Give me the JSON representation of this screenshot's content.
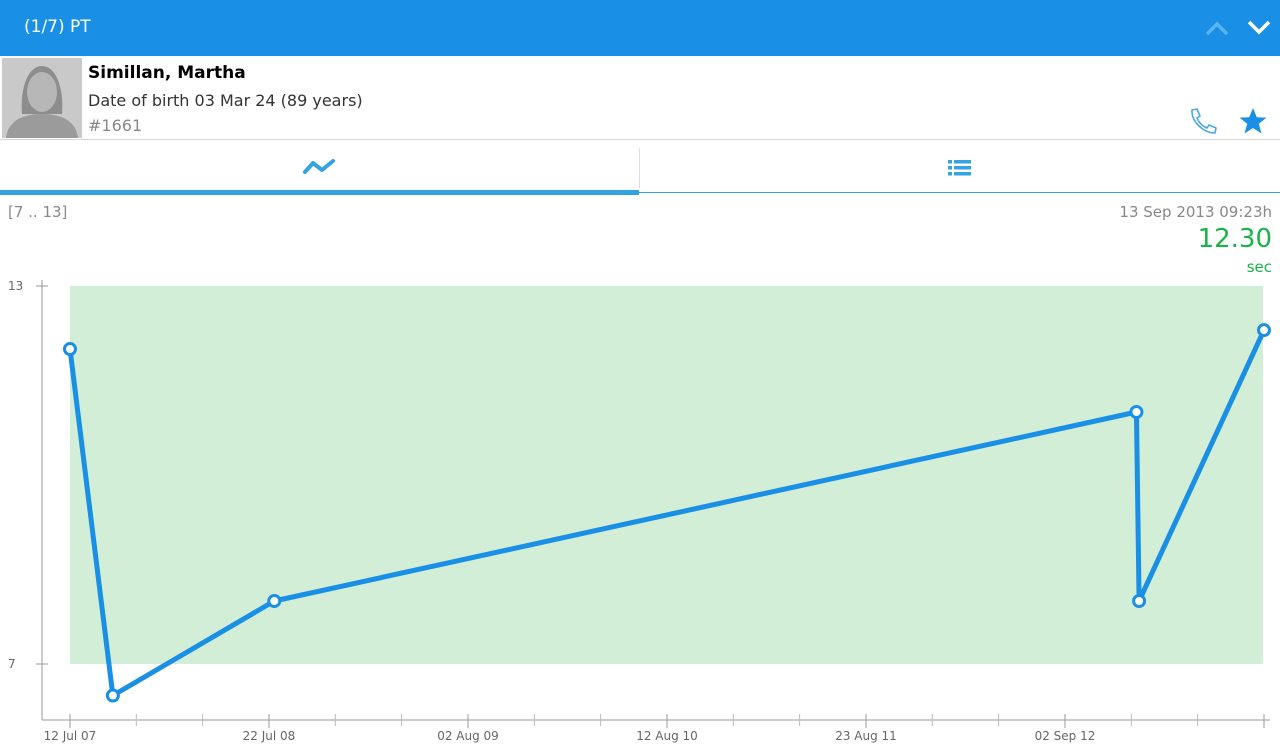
{
  "header": {
    "title": "(1/7) PT",
    "prev_icon": "chevron-up-icon",
    "next_icon": "chevron-down-icon",
    "bar_color": "#1a8fe6"
  },
  "patient": {
    "name": "Simillan, Martha",
    "dob": "Date of birth 03 Mar 24 (89 years)",
    "id": "#1661",
    "actions": [
      "phone-icon",
      "star-icon"
    ]
  },
  "tabs": [
    {
      "icon": "trend-chart-icon",
      "selected": true
    },
    {
      "icon": "list-icon",
      "selected": false
    }
  ],
  "reading": {
    "range": "[7 .. 13]",
    "timestamp": "13 Sep 2013 09:23h",
    "value": "12.30",
    "unit": "sec",
    "accent": "#19b34a"
  },
  "chart_data": {
    "type": "line",
    "ylim": [
      7,
      13
    ],
    "yticks": [
      "13",
      "7"
    ],
    "normal_range": [
      7,
      13
    ],
    "xticks": [
      "12 Jul 07",
      "22 Jul 08",
      "02 Aug 09",
      "12 Aug 10",
      "23 Aug 11",
      "02 Sep 12"
    ],
    "x": [
      "2007-07-12",
      "2007-10-01",
      "2008-08-01",
      "2013-01-15",
      "2013-01-20",
      "2013-09-13"
    ],
    "values": [
      12.0,
      6.5,
      8.0,
      11.0,
      8.0,
      12.3
    ],
    "line_color": "#1a8fe6",
    "band_color": "#d2eed6",
    "grid": false
  }
}
